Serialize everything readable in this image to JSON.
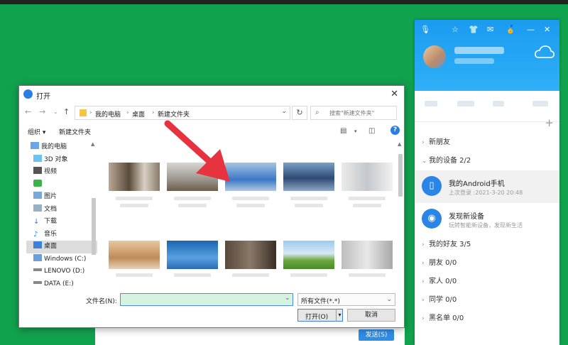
{
  "colors": {
    "background": "#11a24e",
    "qq_header": "#1a9bf0",
    "accent": "#2a7de1",
    "arrow": "#e6333f"
  },
  "qq_panel": {
    "groups_top": [
      {
        "label": "新朋友",
        "arrow": "›"
      },
      {
        "label": "我的设备 2/2",
        "arrow": "⌄"
      }
    ],
    "devices": [
      {
        "name": "我的Android手机",
        "detail": "上次登录 :2021-3-20 20:48",
        "icon": "phone-icon"
      },
      {
        "name": "发现新设备",
        "detail": "玩转智能新设备，发现新生活",
        "icon": "wifi-icon"
      }
    ],
    "groups_bottom": [
      {
        "label": "我的好友 3/5",
        "arrow": "›"
      },
      {
        "label": "朋友 0/0",
        "arrow": "›"
      },
      {
        "label": "家人 0/0",
        "arrow": "›"
      },
      {
        "label": "同学 0/0",
        "arrow": "›"
      },
      {
        "label": "黑名单 0/0",
        "arrow": "›"
      }
    ],
    "plus": "+",
    "toolbar_glyphs": {
      "minimize": "—",
      "close": "✕"
    }
  },
  "dialog": {
    "title": "打开",
    "breadcrumbs": [
      "我的电脑",
      "桌面",
      "新建文件夹"
    ],
    "search_placeholder": "搜索\"新建文件夹\"",
    "toolbar": {
      "organize": "组织 ▾",
      "new_folder": "新建文件夹",
      "help": "?"
    },
    "nav_items": [
      {
        "label": "我的电脑",
        "icon": "computer-icon"
      },
      {
        "label": "3D 对象",
        "icon": "3d-objects-icon"
      },
      {
        "label": "视频",
        "icon": "video-icon"
      },
      {
        "label": "",
        "icon": "wechat-icon"
      },
      {
        "label": "图片",
        "icon": "pictures-icon"
      },
      {
        "label": "文档",
        "icon": "documents-icon"
      },
      {
        "label": "下载",
        "icon": "download-icon"
      },
      {
        "label": "音乐",
        "icon": "music-icon"
      },
      {
        "label": "桌面",
        "icon": "desktop-icon",
        "selected": true
      },
      {
        "label": "Windows (C:)",
        "icon": "drive-icon"
      },
      {
        "label": "LENOVO (D:)",
        "icon": "drive-icon"
      },
      {
        "label": "DATA (E:)",
        "icon": "drive-icon"
      }
    ],
    "filename_label": "文件名(N):",
    "filename_value": "",
    "filetype": "所有文件(*.*)",
    "open_button": "打开(O)",
    "cancel_button": "取消"
  },
  "chat": {
    "send_button": "发送(S)"
  }
}
